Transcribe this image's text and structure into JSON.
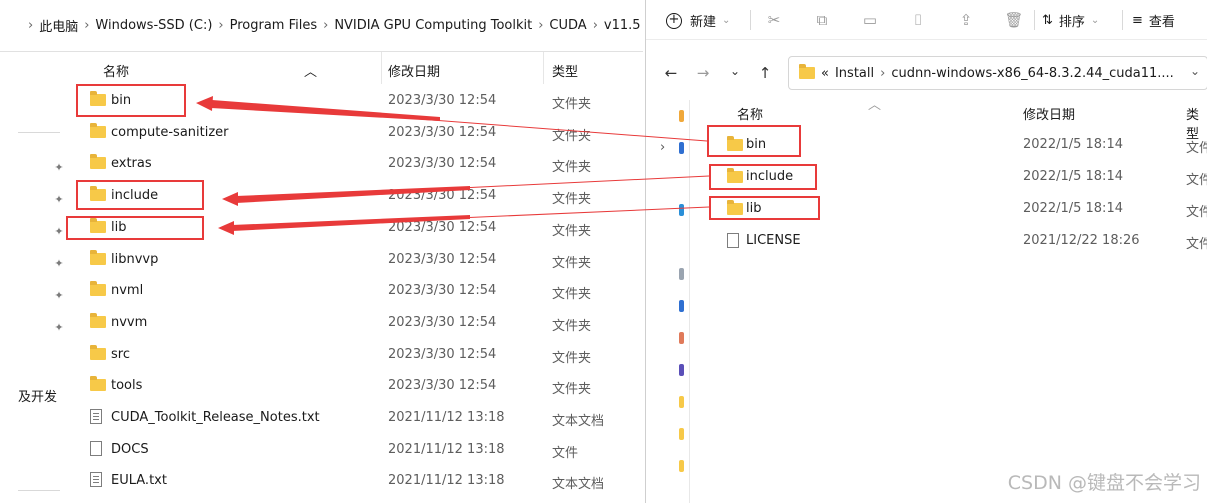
{
  "left_window": {
    "breadcrumb": [
      "此电脑",
      "Windows-SSD (C:)",
      "Program Files",
      "NVIDIA GPU Computing Toolkit",
      "CUDA",
      "v11.5"
    ],
    "nav_text": "及开发",
    "columns": {
      "name": "名称",
      "date": "修改日期",
      "type": "类型"
    },
    "files": [
      {
        "name": "bin",
        "date": "2023/3/30 12:54",
        "type": "文件夹",
        "icon": "folder-icon"
      },
      {
        "name": "compute-sanitizer",
        "date": "2023/3/30 12:54",
        "type": "文件夹",
        "icon": "folder-icon"
      },
      {
        "name": "extras",
        "date": "2023/3/30 12:54",
        "type": "文件夹",
        "icon": "folder-icon"
      },
      {
        "name": "include",
        "date": "2023/3/30 12:54",
        "type": "文件夹",
        "icon": "folder-icon"
      },
      {
        "name": "lib",
        "date": "2023/3/30 12:54",
        "type": "文件夹",
        "icon": "folder-icon"
      },
      {
        "name": "libnvvp",
        "date": "2023/3/30 12:54",
        "type": "文件夹",
        "icon": "folder-icon"
      },
      {
        "name": "nvml",
        "date": "2023/3/30 12:54",
        "type": "文件夹",
        "icon": "folder-icon"
      },
      {
        "name": "nvvm",
        "date": "2023/3/30 12:54",
        "type": "文件夹",
        "icon": "folder-icon"
      },
      {
        "name": "src",
        "date": "2023/3/30 12:54",
        "type": "文件夹",
        "icon": "folder-icon"
      },
      {
        "name": "tools",
        "date": "2023/3/30 12:54",
        "type": "文件夹",
        "icon": "folder-icon"
      },
      {
        "name": "CUDA_Toolkit_Release_Notes.txt",
        "date": "2021/11/12 13:18",
        "type": "文本文档",
        "icon": "text-file-icon"
      },
      {
        "name": "DOCS",
        "date": "2021/11/12 13:18",
        "type": "文件",
        "icon": "file-icon"
      },
      {
        "name": "EULA.txt",
        "date": "2021/11/12 13:18",
        "type": "文本文档",
        "icon": "text-file-icon"
      }
    ]
  },
  "right_window": {
    "toolbar": {
      "new_label": "新建",
      "sort_label": "排序",
      "view_label": "查看"
    },
    "address": {
      "prefix": "«",
      "path": [
        "Install",
        "cudnn-windows-x86_64-8.3.2.44_cuda11...."
      ]
    },
    "columns": {
      "name": "名称",
      "date": "修改日期",
      "type": "类型"
    },
    "files": [
      {
        "name": "bin",
        "date": "2022/1/5 18:14",
        "type": "文件夹",
        "icon": "folder-icon"
      },
      {
        "name": "include",
        "date": "2022/1/5 18:14",
        "type": "文件夹",
        "icon": "folder-icon"
      },
      {
        "name": "lib",
        "date": "2022/1/5 18:14",
        "type": "文件夹",
        "icon": "folder-icon"
      },
      {
        "name": "LICENSE",
        "date": "2021/12/22 18:26",
        "type": "文件",
        "icon": "file-icon"
      }
    ]
  },
  "annotation_color": "#e83a3a",
  "watermark": "CSDN @键盘不会学习"
}
